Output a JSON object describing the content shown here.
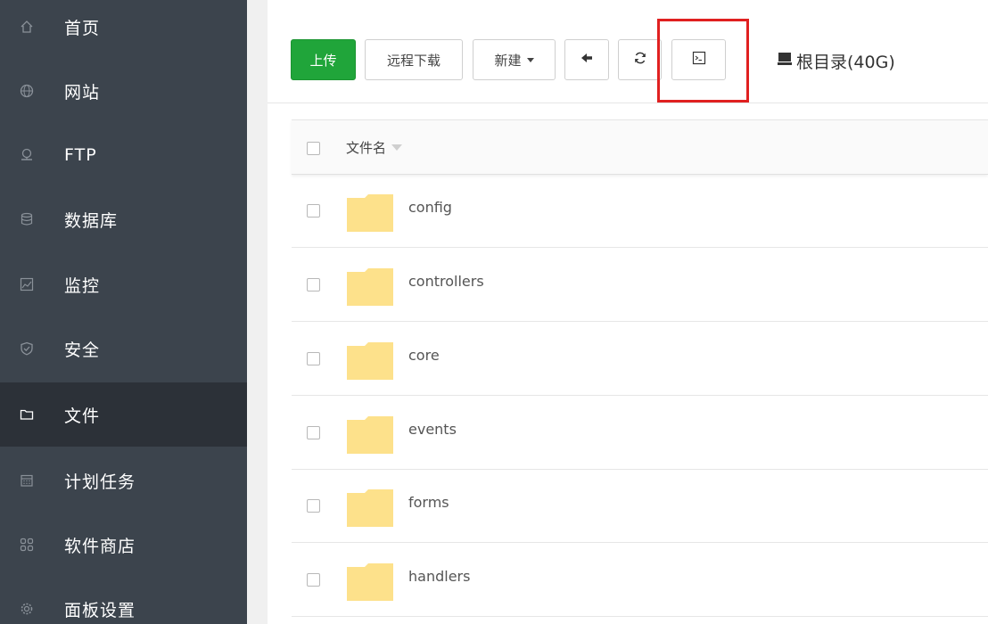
{
  "sidebar": {
    "items": [
      {
        "label": "首页",
        "icon": "home-icon",
        "active": false
      },
      {
        "label": "网站",
        "icon": "globe-icon",
        "active": false
      },
      {
        "label": "FTP",
        "icon": "ftp-icon",
        "active": false
      },
      {
        "label": "数据库",
        "icon": "database-icon",
        "active": false
      },
      {
        "label": "监控",
        "icon": "monitor-icon",
        "active": false
      },
      {
        "label": "安全",
        "icon": "shield-icon",
        "active": false
      },
      {
        "label": "文件",
        "icon": "folder-icon",
        "active": true
      },
      {
        "label": "计划任务",
        "icon": "calendar-icon",
        "active": false
      },
      {
        "label": "软件商店",
        "icon": "apps-icon",
        "active": false
      },
      {
        "label": "面板设置",
        "icon": "gear-icon",
        "active": false
      }
    ]
  },
  "toolbar": {
    "upload_label": "上传",
    "remote_download_label": "远程下载",
    "new_label": "新建",
    "back_icon": "arrow-left-icon",
    "refresh_icon": "refresh-icon",
    "terminal_icon": "terminal-icon",
    "root_label": "根目录(40G)",
    "root_icon": "drive-icon"
  },
  "table": {
    "header": {
      "name_label": "文件名"
    },
    "rows": [
      {
        "name": "config"
      },
      {
        "name": "controllers"
      },
      {
        "name": "core"
      },
      {
        "name": "events"
      },
      {
        "name": "forms"
      },
      {
        "name": "handlers"
      }
    ]
  },
  "colors": {
    "sidebar_bg": "#3c444d",
    "sidebar_active_bg": "#2c3138",
    "primary_green": "#20a53a",
    "highlight_red": "#e02020",
    "folder_yellow": "#fde18b"
  }
}
